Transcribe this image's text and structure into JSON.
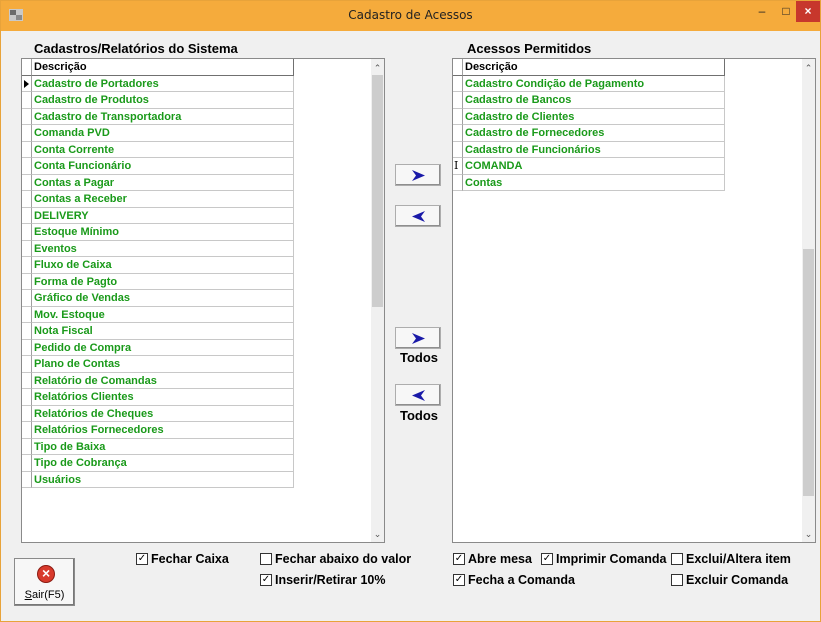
{
  "window": {
    "title": "Cadastro de Acessos",
    "min": "–",
    "max": "□",
    "close": "×"
  },
  "left_panel": {
    "title": "Cadastros/Relatórios do Sistema",
    "column_header": "Descrição",
    "items": [
      "Cadastro de Portadores",
      "Cadastro de Produtos",
      "Cadastro de Transportadora",
      "Comanda PVD",
      "Conta Corrente",
      "Conta Funcionário",
      "Contas a Pagar",
      "Contas a Receber",
      "DELIVERY",
      "Estoque Mínimo",
      "Eventos",
      "Fluxo de Caixa",
      "Forma de Pagto",
      "Gráfico de Vendas",
      "Mov. Estoque",
      "Nota Fiscal",
      "Pedido de Compra",
      "Plano de Contas",
      "Relatório de Comandas",
      "Relatórios Clientes",
      "Relatórios de Cheques",
      "Relatórios Fornecedores",
      "Tipo de Baixa",
      "Tipo de Cobrança",
      "Usuários"
    ]
  },
  "right_panel": {
    "title": "Acessos Permitidos",
    "column_header": "Descrição",
    "items": [
      "Cadastro Condição de Pagamento",
      "Cadastro de Bancos",
      "Cadastro de Clientes",
      "Cadastro de Fornecedores",
      "Cadastro de Funcionários",
      "COMANDA",
      "Contas"
    ]
  },
  "buttons": {
    "todos_label": "Todos",
    "exit_shortcut": "S",
    "exit_label": "air(F5)"
  },
  "options": {
    "fechar_caixa": {
      "label": "Fechar Caixa",
      "checked": true
    },
    "fechar_abaixo": {
      "label": "Fechar abaixo do valor",
      "checked": false
    },
    "inserir_retirar": {
      "label": "Inserir/Retirar  10%",
      "checked": true
    },
    "abre_mesa": {
      "label": "Abre mesa",
      "checked": true
    },
    "imprimir_comanda": {
      "label": "Imprimir Comanda",
      "checked": true
    },
    "exclui_altera": {
      "label": "Exclui/Altera item",
      "checked": false
    },
    "fecha_comanda": {
      "label": "Fecha a Comanda",
      "checked": true
    },
    "excluir_comanda": {
      "label": "Excluir Comanda",
      "checked": false
    }
  },
  "colors": {
    "titlebar": "#f5ab3c",
    "item_text": "#1a9a1a",
    "arrow_right": "#1a1aa8",
    "arrow_left": "#1a1aa8"
  }
}
